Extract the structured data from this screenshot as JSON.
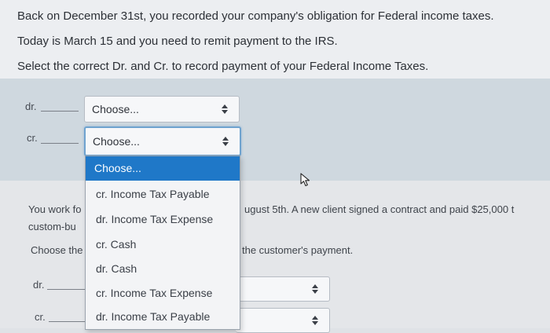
{
  "question1": {
    "line1": "Back on December 31st, you recorded your company's obligation for Federal income taxes.",
    "line2": "Today is March 15 and you need to remit payment to the IRS.",
    "line3": "Select the correct Dr. and Cr. to record payment of your Federal Income Taxes."
  },
  "answer1": {
    "dr_label": "dr.",
    "cr_label": "cr.",
    "dr_select_value": "Choose...",
    "cr_select_value": "Choose..."
  },
  "dropdown": {
    "options": [
      "Choose...",
      "cr. Income Tax Payable",
      "dr. Income Tax Expense",
      "cr. Cash",
      "dr. Cash",
      "cr. Income Tax Expense",
      "dr. Income Tax Payable"
    ],
    "highlighted_index": 0
  },
  "question2": {
    "line1_left": "You work fo",
    "line1_right": "ugust 5th. A new client signed a contract and paid $25,000 t",
    "line2_left": "custom-bu",
    "line3_left": "Choose the",
    "line3_right": "the customer's payment.",
    "dr_label": "dr.",
    "cr_label": "cr."
  },
  "icons": {
    "select_arrows": "up-down-arrows-icon",
    "mouse_cursor": "pointer-arrow-icon"
  },
  "colors": {
    "highlight_blue": "#1f78c8",
    "focus_border": "#6fa3cf"
  }
}
